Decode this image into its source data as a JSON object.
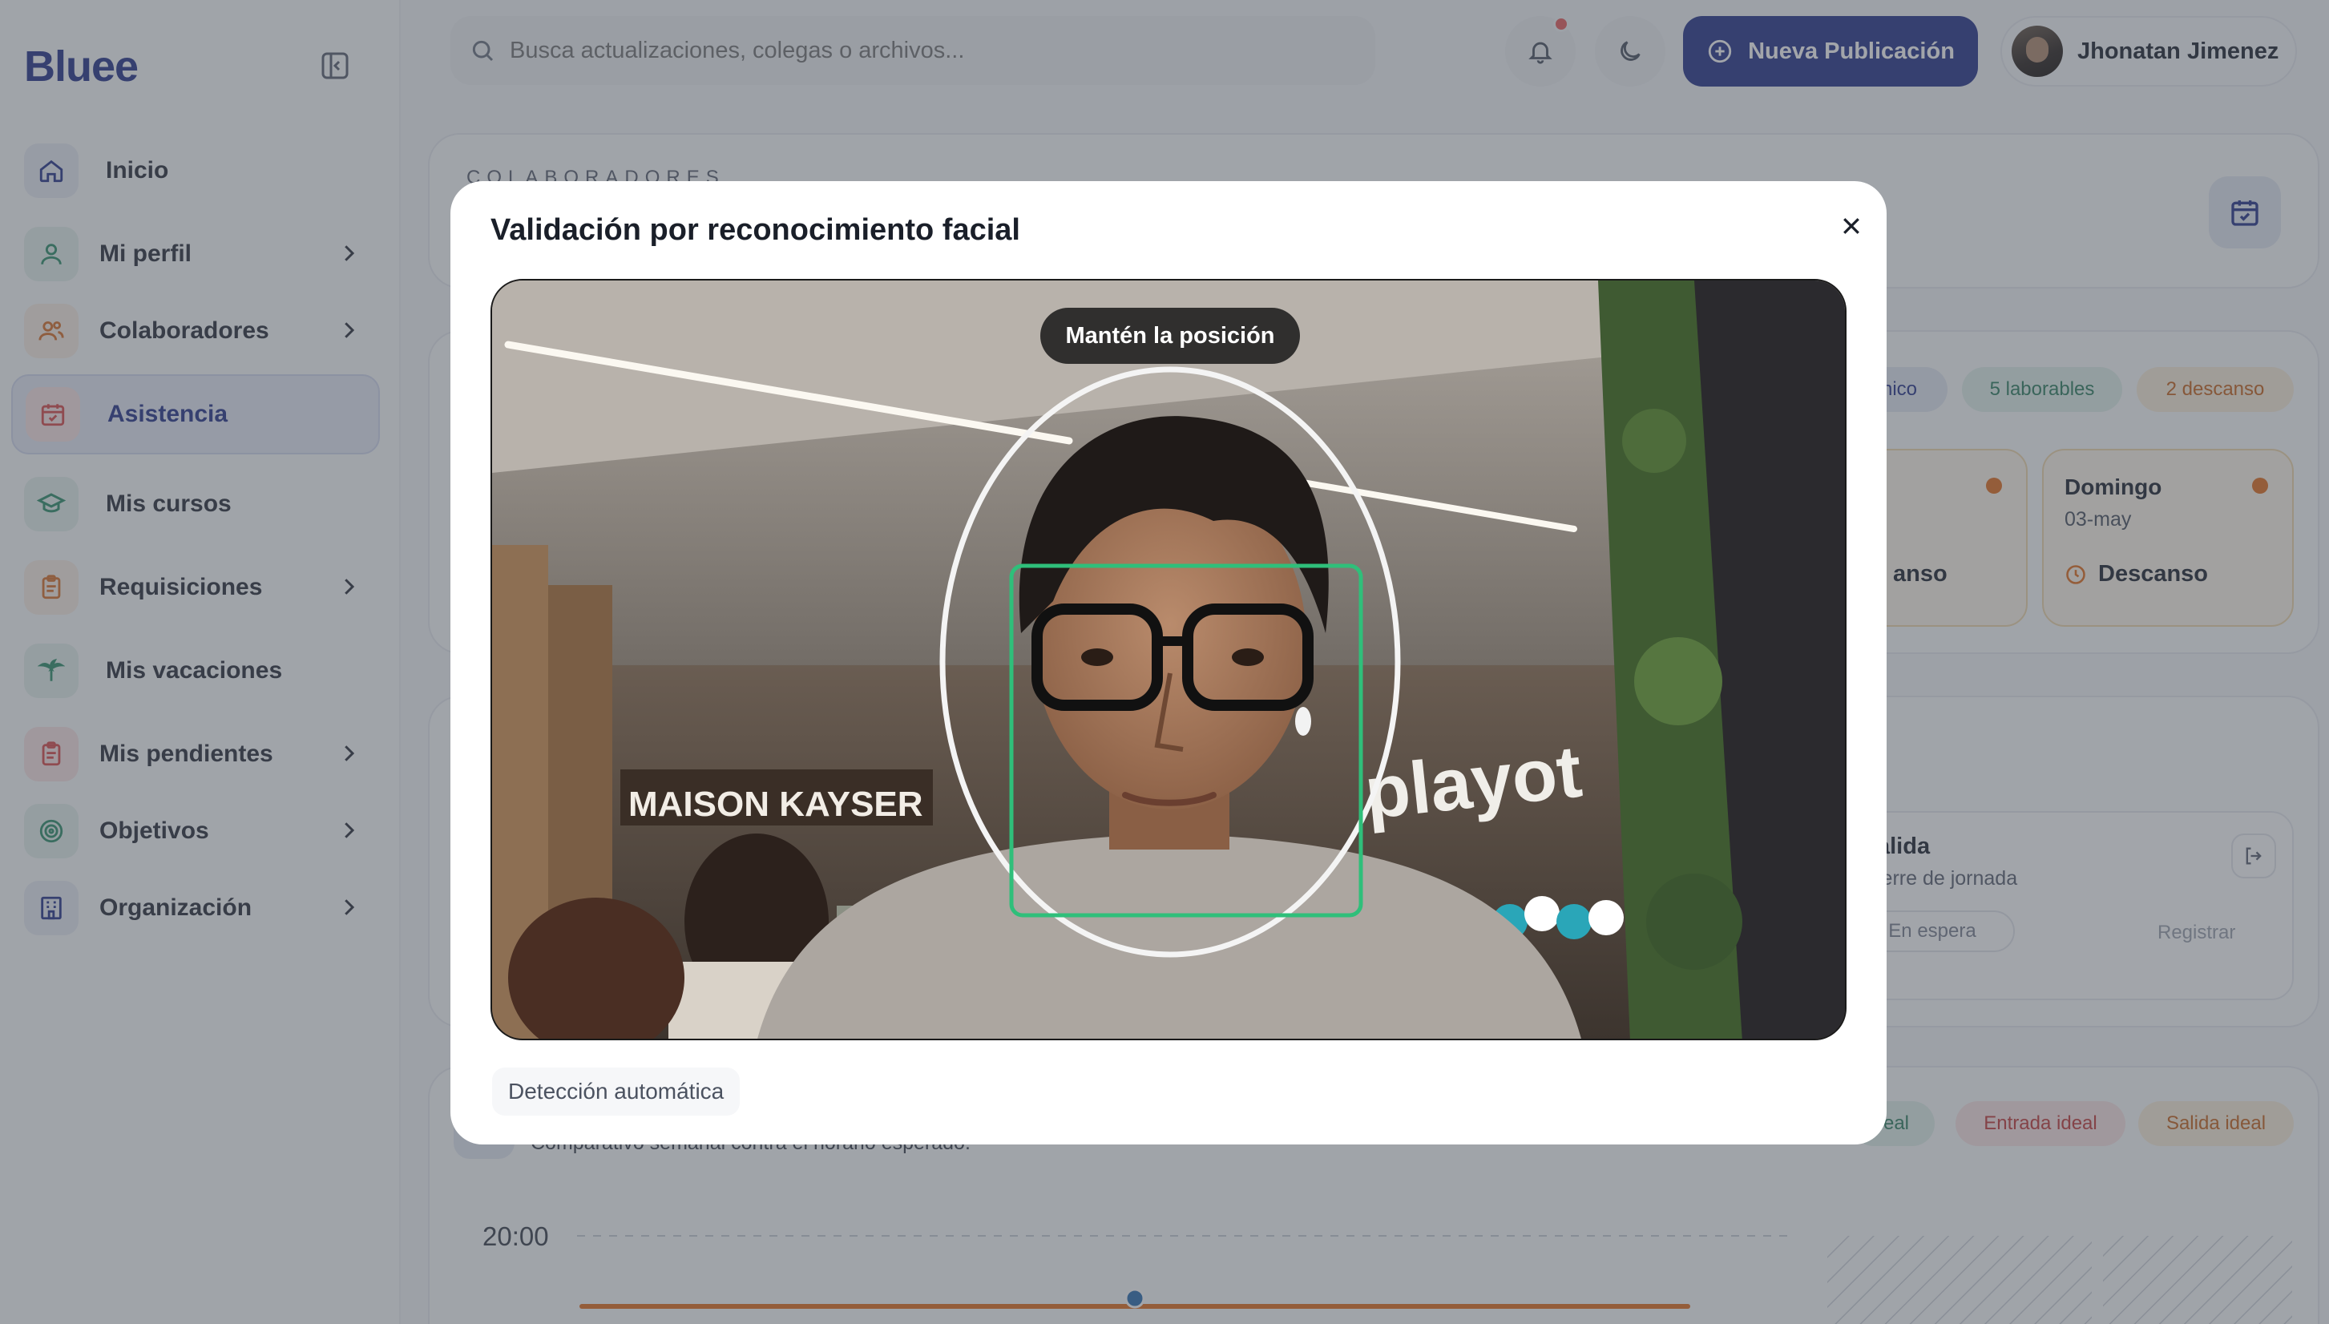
{
  "brand": {
    "logo": "Bluee",
    "primary_color": "#27348b"
  },
  "sidebar": {
    "items": [
      {
        "label": "Inicio",
        "icon": "home-icon",
        "color": "#27348b"
      },
      {
        "label": "Mi perfil",
        "icon": "user-icon",
        "color": "#2f8f6b"
      },
      {
        "label": "Colaboradores",
        "icon": "users-icon",
        "color": "#d9702a"
      },
      {
        "label": "Asistencia",
        "icon": "calendar-icon",
        "color": "#d94b4b",
        "active": true
      },
      {
        "label": "Mis cursos",
        "icon": "graduation-cap-icon",
        "color": "#2f8f6b"
      },
      {
        "label": "Requisiciones",
        "icon": "clipboard-icon",
        "color": "#d9702a"
      },
      {
        "label": "Mis vacaciones",
        "icon": "palm-tree-icon",
        "color": "#2f8f6b"
      },
      {
        "label": "Mis pendientes",
        "icon": "clipboard-list-icon",
        "color": "#d94b4b"
      },
      {
        "label": "Objetivos",
        "icon": "target-icon",
        "color": "#2f8f6b"
      },
      {
        "label": "Organización",
        "icon": "building-icon",
        "color": "#27348b"
      }
    ]
  },
  "topbar": {
    "search_placeholder": "Busca actualizaciones, colegas o archivos...",
    "new_post_label": "Nueva Publicación",
    "user_name": "Jhonatan Jimenez"
  },
  "background": {
    "section_title": "COLABORADORES",
    "pills": [
      "nico",
      "5 laborables",
      "2 descanso"
    ],
    "day_cards": [
      {
        "name": "",
        "date": "",
        "state": "anso"
      },
      {
        "name": "Domingo",
        "date": "03-may",
        "state": "Descanso"
      }
    ],
    "exit_card": {
      "title": "alida",
      "subtitle": "ierre de jornada",
      "status": "En espera",
      "action": "Registrar"
    },
    "chart_legend": [
      "real",
      "Entrada ideal",
      "Salida ideal"
    ],
    "chart_subtitle": "Comparativo semanal contra el horario esperado.",
    "chart_y_label": "20:00"
  },
  "modal": {
    "title": "Validación por reconocimiento facial",
    "camera_hint": "Mantén la posición",
    "detection_mode": "Detección automática",
    "scene_sign_left": "MAISON KAYSER",
    "scene_sign_right": "playot"
  }
}
